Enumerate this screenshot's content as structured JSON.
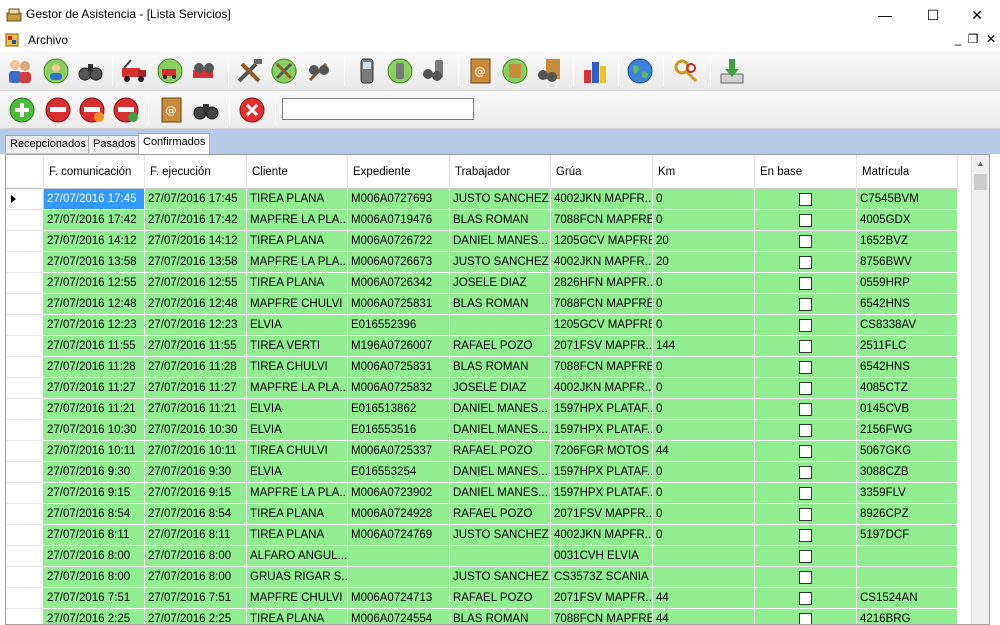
{
  "window": {
    "title": "Gestor de Asistencia - [Lista Servicios]",
    "minimize": "—",
    "maximize": "☐",
    "close": "✕"
  },
  "menu": {
    "archivo": "Archivo",
    "mdi_min": "_",
    "mdi_restore": "❐",
    "mdi_close": "✕"
  },
  "colors": {
    "row_green": "#90ee90",
    "selection": "#3399ff",
    "tab_strip": "#b5cbe8"
  },
  "toolbar1": {
    "icons": [
      "users-icon",
      "add-user-icon",
      "search-users-icon",
      "truck-icon",
      "add-truck-icon",
      "search-truck-icon",
      "tools-icon",
      "add-tools-icon",
      "search-tools-icon",
      "phone-icon",
      "add-phone-icon",
      "search-phone-icon",
      "address-book-icon",
      "add-address-icon",
      "search-address-icon",
      "chart-icon",
      "globe-icon",
      "keys-icon",
      "download-icon"
    ]
  },
  "toolbar2": {
    "icons": [
      "add-icon",
      "remove-red-icon",
      "remove-orange-icon",
      "remove-green-icon",
      "address-book-icon",
      "binoculars-icon",
      "cancel-icon"
    ],
    "search_value": ""
  },
  "tabs": [
    {
      "label": "Recepcionados"
    },
    {
      "label": "Pasados"
    },
    {
      "label": "Confirmados"
    }
  ],
  "grid": {
    "headers": [
      "F. comunicación",
      "F. ejecución",
      "Cliente",
      "Expediente",
      "Trabajador",
      "Grúa",
      "Km",
      "En base",
      "Matrícula"
    ],
    "rows": [
      [
        "27/07/2016 17:45",
        "27/07/2016 17:45",
        "TIREA PLANA",
        "M006A0727693",
        "JUSTO SANCHEZ",
        "4002JKN MAPFR...",
        "0",
        "",
        "C7545BVM"
      ],
      [
        "27/07/2016 17:42",
        "27/07/2016 17:42",
        "MAPFRE LA PLA...",
        "M006A0719476",
        "BLAS ROMAN",
        "7088FCN MAPFRE",
        "0",
        "",
        "4005GDX"
      ],
      [
        "27/07/2016 14:12",
        "27/07/2016 14:12",
        "TIREA PLANA",
        "M006A0726722",
        "DANIEL   MANES...",
        "1205GCV MAPFRE",
        "20",
        "",
        "1652BVZ"
      ],
      [
        "27/07/2016 13:58",
        "27/07/2016 13:58",
        "MAPFRE LA PLA...",
        "M006A0726673",
        "JUSTO SANCHEZ",
        "4002JKN MAPFR...",
        "20",
        "",
        "8756BWV"
      ],
      [
        "27/07/2016 12:55",
        "27/07/2016 12:55",
        "TIREA PLANA",
        "M006A0726342",
        "JOSELE DIAZ",
        "2826HFN MAPFR...",
        "0",
        "",
        "0559HRP"
      ],
      [
        "27/07/2016 12:48",
        "27/07/2016 12:48",
        "MAPFRE CHULVI",
        "M006A0725831",
        "BLAS ROMAN",
        "7088FCN MAPFRE",
        "0",
        "",
        "6542HNS"
      ],
      [
        "27/07/2016 12:23",
        "27/07/2016 12:23",
        "ELVIA",
        "E016552396",
        "",
        "1205GCV MAPFRE",
        "0",
        "",
        "CS8338AV"
      ],
      [
        "27/07/2016 11:55",
        "27/07/2016 11:55",
        "TIREA VERTI",
        "M196A0726007",
        "RAFAEL POZO",
        "2071FSV MAPFR...",
        "144",
        "",
        "2511FLC"
      ],
      [
        "27/07/2016 11:28",
        "27/07/2016 11:28",
        "TIREA CHULVI",
        "M006A0725831",
        "BLAS ROMAN",
        "7088FCN MAPFRE",
        "0",
        "",
        "6542HNS"
      ],
      [
        "27/07/2016 11:27",
        "27/07/2016 11:27",
        "MAPFRE LA PLA...",
        "M006A0725832",
        "JOSELE DIAZ",
        "4002JKN MAPFR...",
        "0",
        "",
        "4085CTZ"
      ],
      [
        "27/07/2016 11:21",
        "27/07/2016 11:21",
        "ELVIA",
        "E016513862",
        "DANIEL   MANES...",
        "1597HPX PLATAF...",
        "0",
        "",
        "0145CVB"
      ],
      [
        "27/07/2016 10:30",
        "27/07/2016 10:30",
        "ELVIA",
        "E016553516",
        "DANIEL   MANES...",
        "1597HPX PLATAF...",
        "0",
        "",
        "2156FWG"
      ],
      [
        "27/07/2016 10:11",
        "27/07/2016 10:11",
        "TIREA CHULVI",
        "M006A0725337",
        "RAFAEL POZO",
        "7206FGR MOTOS",
        "44",
        "",
        "5067GKG"
      ],
      [
        "27/07/2016 9:30",
        "27/07/2016 9:30",
        "ELVIA",
        "E016553254",
        "DANIEL   MANES...",
        "1597HPX PLATAF...",
        "0",
        "",
        "3088CZB"
      ],
      [
        "27/07/2016 9:15",
        "27/07/2016 9:15",
        "MAPFRE LA PLA...",
        "M006A0723902",
        "DANIEL   MANES...",
        "1597HPX PLATAF...",
        "0",
        "",
        "3359FLV"
      ],
      [
        "27/07/2016 8:54",
        "27/07/2016 8:54",
        "TIREA PLANA",
        "M006A0724928",
        "RAFAEL POZO",
        "2071FSV MAPFR...",
        "0",
        "",
        "8926CPZ"
      ],
      [
        "27/07/2016 8:11",
        "27/07/2016 8:11",
        "TIREA PLANA",
        "M006A0724769",
        "JUSTO SANCHEZ",
        "4002JKN MAPFR...",
        "0",
        "",
        "5197DCF"
      ],
      [
        "27/07/2016 8:00",
        "27/07/2016 8:00",
        "ALFARO ANGUL...",
        "",
        "",
        "0031CVH ELVIA",
        "",
        "",
        ""
      ],
      [
        "27/07/2016 8:00",
        "27/07/2016 8:00",
        "GRUAS RIGAR S....",
        "",
        "JUSTO SANCHEZ",
        "CS3573Z SCANIA",
        "",
        "",
        ""
      ],
      [
        "27/07/2016 7:51",
        "27/07/2016 7:51",
        "MAPFRE CHULVI",
        "M006A0724713",
        "RAFAEL POZO",
        "2071FSV MAPFR...",
        "44",
        "",
        "CS1524AN"
      ],
      [
        "27/07/2016 2:25",
        "27/07/2016 2:25",
        "TIREA PLANA",
        "M006A0724554",
        "BLAS ROMAN",
        "7088FCN MAPFRE",
        "44",
        "",
        "4216BRG"
      ]
    ]
  }
}
